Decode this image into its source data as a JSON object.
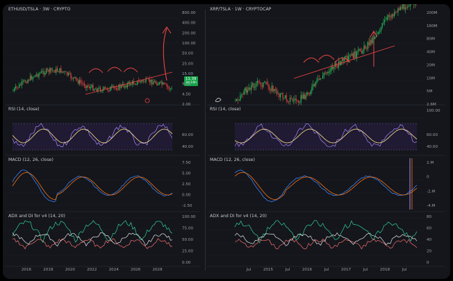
{
  "left": {
    "title": "ETHUSD/TSLA · 3W · CRYPTO",
    "price_ticks": [
      "800.00",
      "400.00",
      "200.00",
      "100.00",
      "50.00",
      "25.00",
      "15.00",
      "9.00",
      "4.50",
      "2.00"
    ],
    "price_badge": "11.39",
    "price_badge_sub": "3d 16h",
    "rsi_label": "RSI (14, close)",
    "rsi_ticks": [
      "60.00",
      "40.00"
    ],
    "macd_label": "MACD (12, 26, close)",
    "macd_ticks": [
      "7.50",
      "5.00",
      "2.50",
      "0.00",
      "-2.50"
    ],
    "adx_label": "ADX and DI for v4 (14, 20)",
    "adx_ticks": [
      "100.00",
      "75.00",
      "50.00",
      "25.00",
      "0.00"
    ],
    "time_ticks": [
      "2016",
      "2018",
      "2020",
      "2022",
      "2024",
      "2026",
      "2028"
    ]
  },
  "right": {
    "title": "XRP/TSLA · 1W · CRYPTOCAP",
    "price_ticks": [
      "200M",
      "160M",
      "80M",
      "40M",
      "20M",
      "10M",
      "5M",
      "2.6M"
    ],
    "rsi_label": "RSI (14, close)",
    "rsi_ticks": [
      "100.00",
      "60.00",
      "40.00"
    ],
    "macd_label": "MACD (12, 26, close)",
    "macd_ticks": [
      "2.M",
      "0",
      "-2.M",
      "-4.M"
    ],
    "adx_label": "ADX and DI for v4 (14, 20)",
    "adx_ticks": [
      "80",
      "60",
      "40",
      "20",
      "0"
    ],
    "time_ticks": [
      "Jul",
      "2015",
      "Jul",
      "2016",
      "Jul",
      "2017",
      "Jul",
      "2018",
      "Jul"
    ]
  },
  "colors": {
    "bg": "#14161b",
    "up": "#22c55e",
    "down": "#ef4444",
    "rsi_line": "#a78bfa",
    "rsi_ma": "#fde68a",
    "macd_line": "#3b82f6",
    "signal_line": "#f97316",
    "adx_green": "#34d399",
    "adx_red": "#f87171",
    "adx_white": "#e5e7eb",
    "annotation": "#ef4444"
  }
}
